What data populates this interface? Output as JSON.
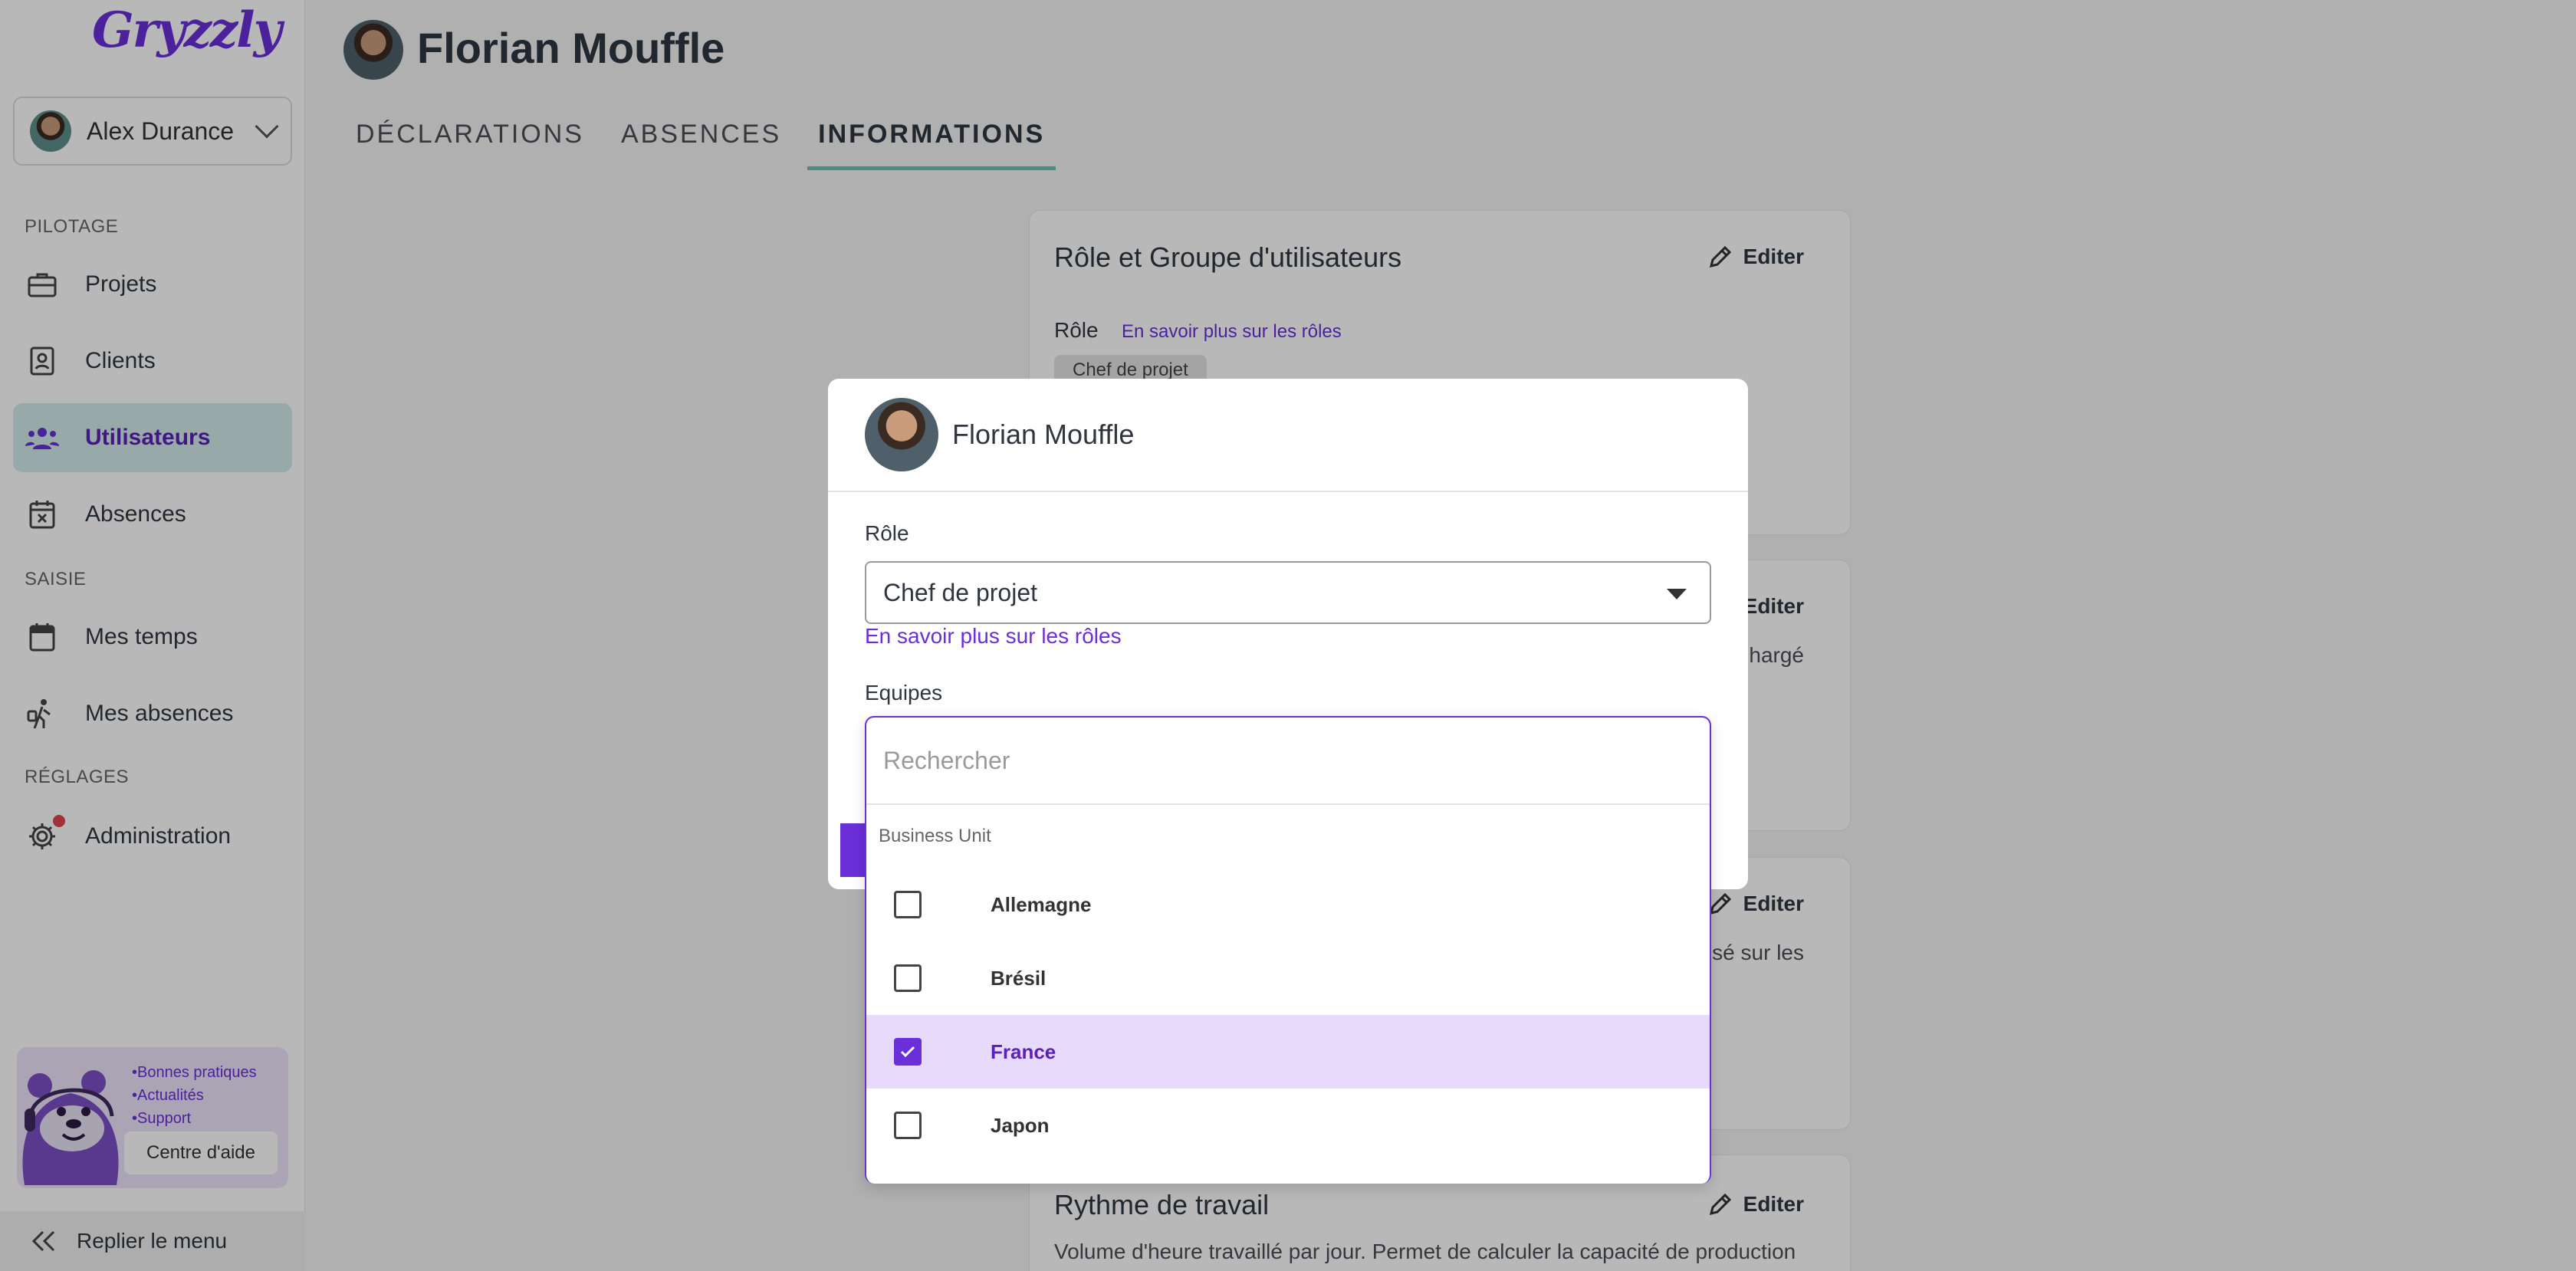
{
  "brand": {
    "logo_text": "Gryzzly",
    "accent": "#6a2fd9",
    "teal": "#67c3b3"
  },
  "user_switcher": {
    "name": "Alex Durance"
  },
  "sidebar": {
    "sections": {
      "pilotage": "PILOTAGE",
      "saisie": "SAISIE",
      "reglages": "RÉGLAGES"
    },
    "items": [
      {
        "label": "Projets",
        "icon": "briefcase-icon"
      },
      {
        "label": "Clients",
        "icon": "contact-card-icon"
      },
      {
        "label": "Utilisateurs",
        "icon": "users-icon",
        "active": true
      },
      {
        "label": "Absences",
        "icon": "calendar-x-icon"
      },
      {
        "label": "Mes temps",
        "icon": "calendar-icon"
      },
      {
        "label": "Mes absences",
        "icon": "traveler-icon"
      },
      {
        "label": "Administration",
        "icon": "gear-icon",
        "badge": true
      }
    ],
    "help": {
      "bullets": [
        "•Bonnes pratiques",
        "•Actualités",
        "•Support"
      ],
      "button": "Centre d'aide"
    },
    "collapse_label": "Replier le menu"
  },
  "page": {
    "title": "Florian Mouffle",
    "tabs": [
      "DÉCLARATIONS",
      "ABSENCES",
      "INFORMATIONS"
    ],
    "active_tab": "INFORMATIONS"
  },
  "cards": {
    "role_group": {
      "title": "Rôle et Groupe d'utilisateurs",
      "edit": "Editer",
      "role_label": "Rôle",
      "role_link": "En savoir plus sur les rôles",
      "role_chip": "Chef de projet"
    },
    "card2": {
      "edit": "Editer",
      "text_fragment": "hargé"
    },
    "card3": {
      "edit": "Editer",
      "text_fragment": "sé sur les"
    },
    "work_rhythm": {
      "title": "Rythme de travail",
      "edit": "Editer",
      "text": "Volume d'heure travaillé par jour. Permet de calculer la capacité de production"
    }
  },
  "modal": {
    "user_name": "Florian Mouffle",
    "role_label": "Rôle",
    "role_value": "Chef de projet",
    "role_link": "En savoir plus sur les rôles",
    "teams_label": "Equipes",
    "dropdown": {
      "placeholder": "Rechercher",
      "group": "Business Unit",
      "options": [
        {
          "label": "Allemagne",
          "checked": false
        },
        {
          "label": "Brésil",
          "checked": false
        },
        {
          "label": "France",
          "checked": true
        },
        {
          "label": "Japon",
          "checked": false
        }
      ]
    }
  }
}
